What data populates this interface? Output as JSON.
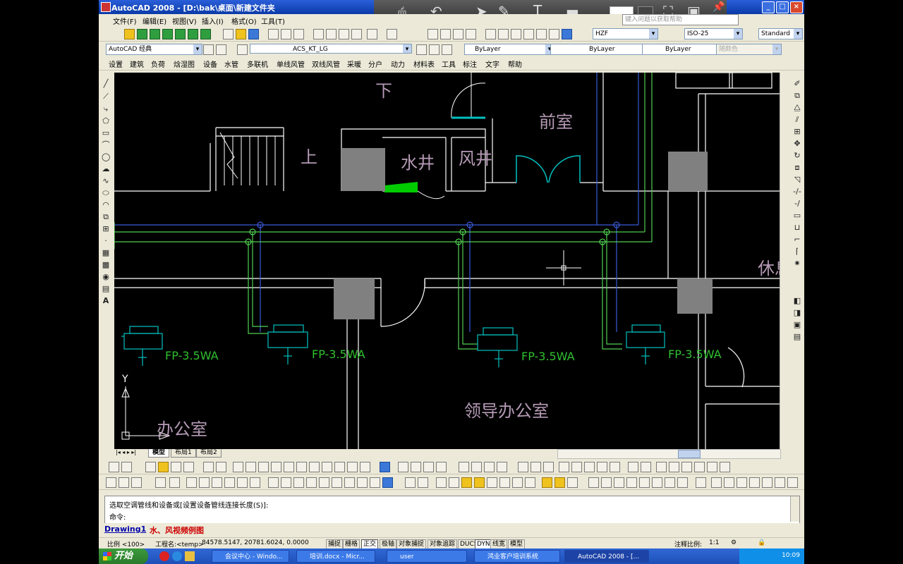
{
  "window": {
    "title": "AutoCAD 2008 - [D:\\bak\\桌面\\新建文件夹",
    "buttons": [
      "_",
      "□",
      "×"
    ],
    "help_placeholder": "键入问题以获取帮助"
  },
  "menubar": {
    "items": [
      "文件(F)",
      "编辑(E)",
      "视图(V)",
      "插入(I)",
      "格式(O)",
      "工具(T)"
    ]
  },
  "toolbar1": {
    "text_style": "HZF",
    "dim_style": "ISO-25",
    "table_style": "Standard"
  },
  "toolbar2": {
    "workspace": "AutoCAD 经典",
    "layer": "ACS_KT_LG",
    "color": "ByLayer",
    "linetype": "ByLayer",
    "lineweight": "ByLayer",
    "plotstyle": "随颜色"
  },
  "custom_menu": {
    "items": [
      "设置",
      "建筑",
      "负荷",
      "焓湿图",
      "设备",
      "水管",
      "多联机",
      "单线风管",
      "双线风管",
      "采暖",
      "分户",
      "动力",
      "材料表",
      "工具",
      "标注",
      "文字",
      "帮助"
    ]
  },
  "drawing": {
    "labels": {
      "down": "下",
      "up": "上",
      "water_shaft": "水井",
      "air_shaft": "风井",
      "anteroom": "前室",
      "rest": "休息",
      "office": "办公室",
      "leader_office": "领导办公室"
    },
    "fan_coil_label": "FP-3.5WA",
    "axis_y": "Y"
  },
  "layout_tabs": [
    "模型",
    "布局1",
    "布局2"
  ],
  "command": {
    "line1": "选取空调管线和设备或[设置设备管线连接长度(S)]:",
    "line2": "命令:"
  },
  "doc_tabs": [
    "Drawing1",
    "水、风视频例图"
  ],
  "status": {
    "scale": "比例 <100>",
    "project": "工程名:<temp>",
    "coords": "84578.5147, 20781.6024, 0.0000",
    "toggles": [
      "捕捉",
      "栅格",
      "正交",
      "极轴",
      "对象捕捉",
      "对象追踪",
      "DUCS",
      "DYN",
      "线宽",
      "模型"
    ],
    "annotation_scale_label": "注释比例:",
    "annotation_scale": "1:1"
  },
  "taskbar": {
    "start": "开始",
    "tasks": [
      "会议中心 - Windo...",
      "培训.docx - Micr...",
      "user",
      "鸿业客户培训系统",
      "AutoCAD 2008 - [..."
    ],
    "clock": "10:09"
  }
}
